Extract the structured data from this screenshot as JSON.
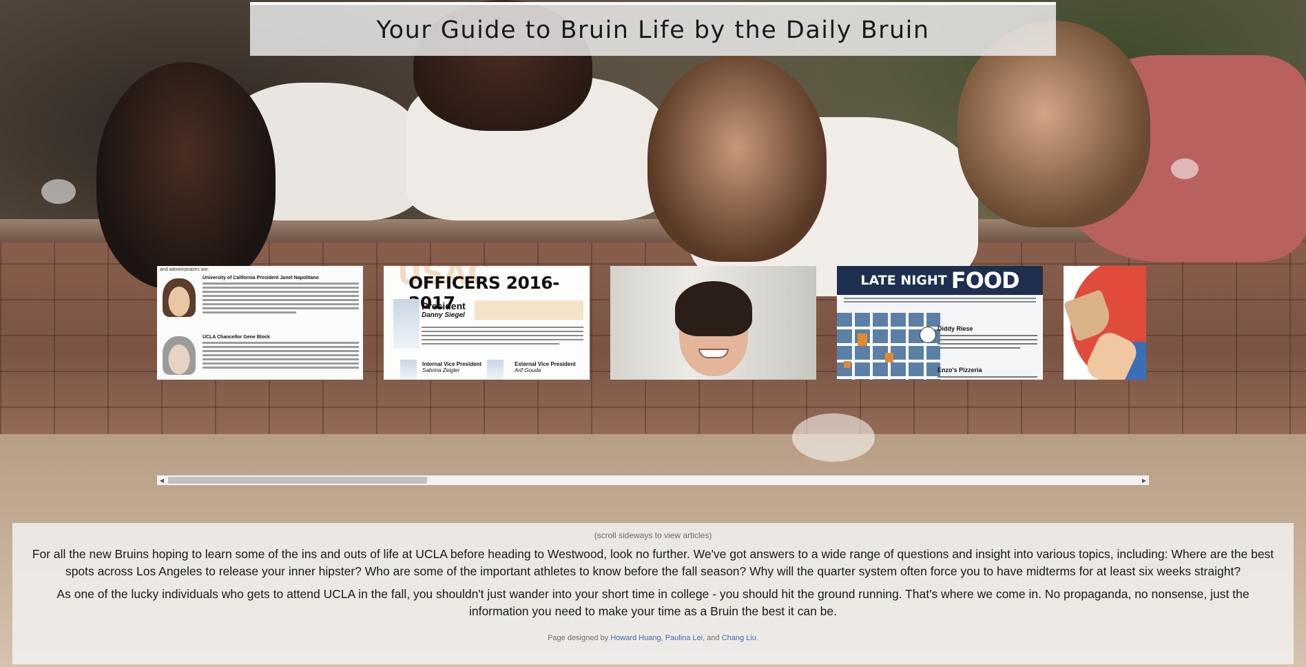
{
  "page": {
    "title": "Your Guide to Bruin Life by the Daily Bruin"
  },
  "carousel": {
    "cards": [
      {
        "name": "administrators",
        "intro": "and administrators are:",
        "heading1": "University of California President Janet Napolitano",
        "heading2": "UCLA Chancellor Gene Block"
      },
      {
        "name": "officers",
        "ghost": "USAC",
        "title": "OFFICERS 2016-2017",
        "role": "President",
        "person": "Danny Siegel",
        "sub_left": "Internal Vice President",
        "sub_left_name": "Sabrina Zeigler",
        "sub_right": "External Vice President",
        "sub_right_name": "Arif Gouda"
      },
      {
        "name": "portrait"
      },
      {
        "name": "late-night-food",
        "band_small": "LATE NIGHT",
        "band_big": "FOOD",
        "spot1": "Diddy Riese",
        "spot2": "Enzo's Pizzeria"
      },
      {
        "name": "illustration"
      }
    ],
    "scroll_position": 0.21
  },
  "info": {
    "hint": "(scroll sideways to view articles)",
    "paragraph1": "For all the new Bruins hoping to learn some of the ins and outs of life at UCLA before heading to Westwood, look no further. We've got answers to a wide range of questions and insight into various topics, including: Where are the best spots across Los Angeles to release your inner hipster? Who are some of the important athletes to know before the fall season? Why will the quarter system often force you to have midterms for at least six weeks straight?",
    "paragraph2": "As one of the lucky individuals who gets to attend UCLA in the fall, you shouldn't just wander into your short time in college - you should hit the ground running. That's where we come in. No propaganda, no nonsense, just the information you need to make your time as a Bruin the best it can be.",
    "credits": {
      "prefix": "Page designed by",
      "designer1": "Howard Huang",
      "sep1": ",",
      "designer2": "Paulina Lei",
      "sep2": ", and",
      "designer3": "Chang Liu",
      "suffix": "."
    }
  },
  "colors": {
    "link": "#3a6aa8",
    "food_band": "#1e2f4f",
    "illustration_red": "#e04b3c"
  }
}
